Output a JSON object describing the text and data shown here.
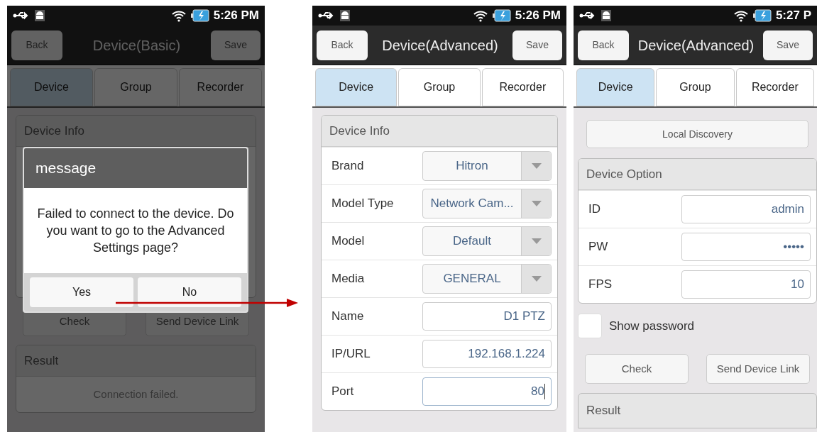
{
  "screens": [
    {
      "kind": "basic",
      "status_bar": {
        "time": "5:26 PM"
      },
      "header": {
        "back": "Back",
        "title": "Device(Basic)",
        "save": "Save"
      },
      "tabs": [
        {
          "label": "Device",
          "selected": true
        },
        {
          "label": "Group",
          "selected": false
        },
        {
          "label": "Recorder",
          "selected": false
        }
      ],
      "device_info": {
        "title": "Device Info"
      },
      "buttons": [
        "Check",
        "Send Device Link"
      ],
      "result": {
        "title": "Result",
        "text": "Connection failed."
      },
      "dialog": {
        "title": "message",
        "text": "Failed to connect to the device. Do you want to go to the Advanced Settings page?",
        "buttons": [
          "Yes",
          "No"
        ]
      }
    },
    {
      "kind": "advanced_info",
      "status_bar": {
        "time": "5:26 PM"
      },
      "header": {
        "back": "Back",
        "title": "Device(Advanced)",
        "save": "Save"
      },
      "tabs": [
        {
          "label": "Device",
          "selected": true
        },
        {
          "label": "Group",
          "selected": false
        },
        {
          "label": "Recorder",
          "selected": false
        }
      ],
      "device_info": {
        "title": "Device Info",
        "rows": [
          {
            "label": "Brand",
            "kind": "dropdown",
            "value": "Hitron"
          },
          {
            "label": "Model Type",
            "kind": "dropdown",
            "value": "Network Cam..."
          },
          {
            "label": "Model",
            "kind": "dropdown",
            "value": "Default"
          },
          {
            "label": "Media",
            "kind": "dropdown",
            "value": "GENERAL"
          },
          {
            "label": "Name",
            "kind": "text",
            "value": "D1 PTZ",
            "focused": false
          },
          {
            "label": "IP/URL",
            "kind": "text",
            "value": "192.168.1.224",
            "focused": false
          },
          {
            "label": "Port",
            "kind": "text",
            "value": "80",
            "focused": true
          }
        ]
      }
    },
    {
      "kind": "advanced_option",
      "status_bar": {
        "time": "5:27 P"
      },
      "header": {
        "back": "Back",
        "title": "Device(Advanced)",
        "save": "Save"
      },
      "tabs": [
        {
          "label": "Device",
          "selected": true
        },
        {
          "label": "Group",
          "selected": false
        },
        {
          "label": "Recorder",
          "selected": false
        }
      ],
      "discovery_button": "Local Discovery",
      "device_option": {
        "title": "Device Option",
        "rows": [
          {
            "label": "ID",
            "kind": "text",
            "value": "admin",
            "focused": false
          },
          {
            "label": "PW",
            "kind": "text",
            "value": "•••••",
            "focused": false
          },
          {
            "label": "FPS",
            "kind": "text",
            "value": "10",
            "focused": false
          }
        ]
      },
      "show_password": {
        "label": "Show password",
        "checked": false
      },
      "buttons": [
        "Check",
        "Send Device Link"
      ],
      "result": {
        "title": "Result"
      }
    }
  ]
}
